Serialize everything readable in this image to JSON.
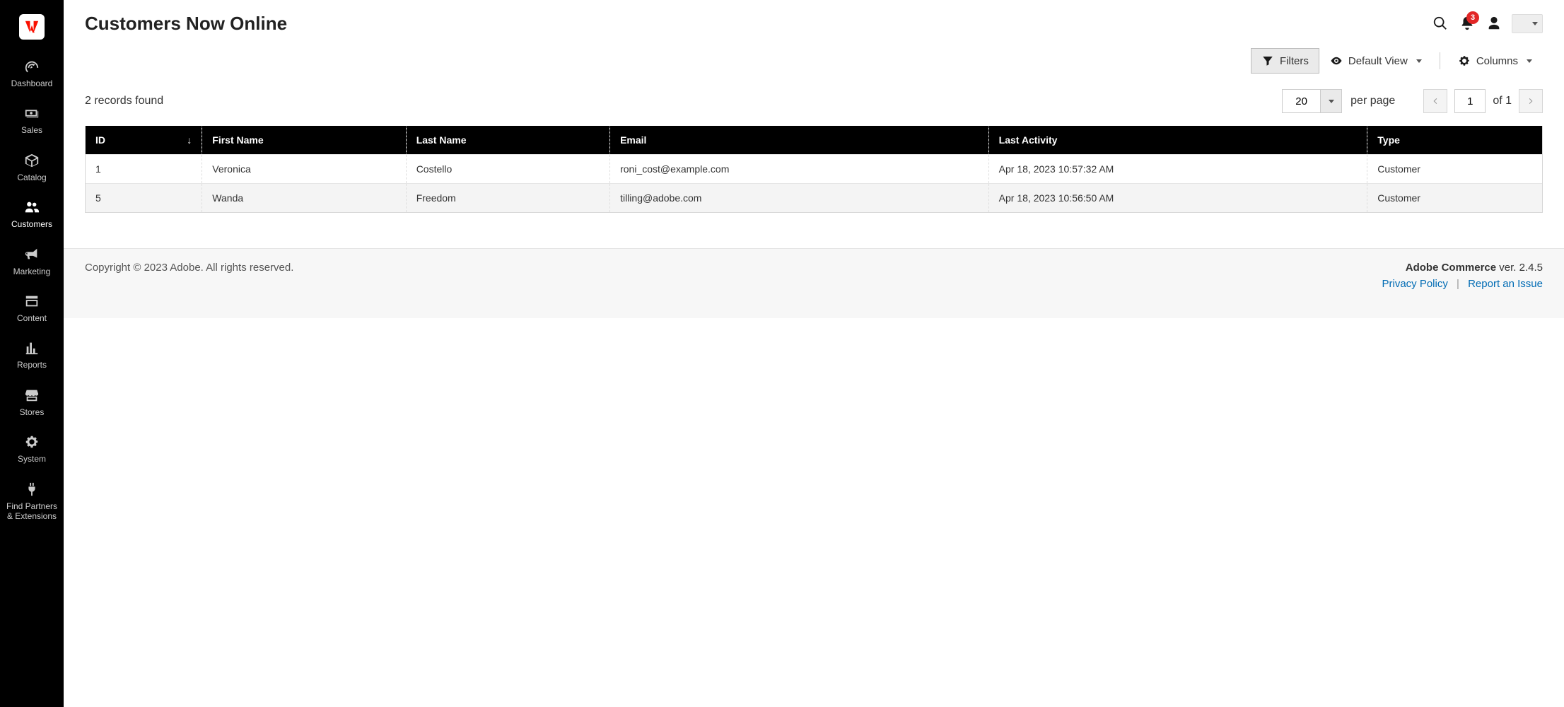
{
  "sidebar": {
    "items": [
      {
        "label": "Dashboard"
      },
      {
        "label": "Sales"
      },
      {
        "label": "Catalog"
      },
      {
        "label": "Customers"
      },
      {
        "label": "Marketing"
      },
      {
        "label": "Content"
      },
      {
        "label": "Reports"
      },
      {
        "label": "Stores"
      },
      {
        "label": "System"
      },
      {
        "label": "Find Partners & Extensions"
      }
    ]
  },
  "header": {
    "title": "Customers Now Online",
    "notifications_count": "3"
  },
  "toolbar": {
    "filters": "Filters",
    "default_view": "Default View",
    "columns": "Columns"
  },
  "records": {
    "found_text": "2 records found",
    "page_size": "20",
    "per_page": "per page",
    "current_page": "1",
    "of_text": "of 1"
  },
  "table": {
    "columns": [
      "ID",
      "First Name",
      "Last Name",
      "Email",
      "Last Activity",
      "Type"
    ],
    "sort_indicator": "↓",
    "rows": [
      {
        "id": "1",
        "first": "Veronica",
        "last": "Costello",
        "email": "roni_cost@example.com",
        "activity": "Apr 18, 2023 10:57:32 AM",
        "type": "Customer"
      },
      {
        "id": "5",
        "first": "Wanda",
        "last": "Freedom",
        "email": "tilling@adobe.com",
        "activity": "Apr 18, 2023 10:56:50 AM",
        "type": "Customer"
      }
    ]
  },
  "footer": {
    "copyright": "Copyright © 2023 Adobe. All rights reserved.",
    "product": "Adobe Commerce",
    "version": " ver. 2.4.5",
    "privacy": "Privacy Policy",
    "report": "Report an Issue"
  }
}
